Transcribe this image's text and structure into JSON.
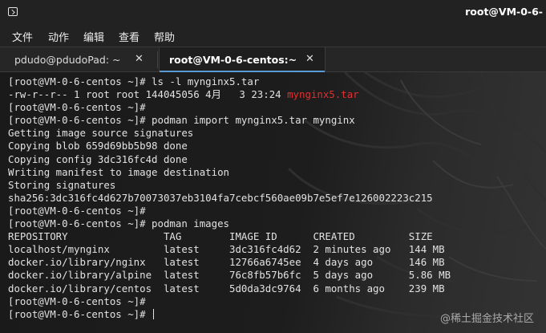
{
  "window": {
    "title": "root@VM-0-6-"
  },
  "menu": {
    "items": [
      "文件",
      "动作",
      "编辑",
      "查看",
      "帮助"
    ]
  },
  "tabs": [
    {
      "label": "pdudo@pdudoPad: ~",
      "close": "✕",
      "active": false
    },
    {
      "label": "root@VM-0-6-centos:~",
      "close": "✕",
      "active": true
    }
  ],
  "terminal": {
    "lines": [
      {
        "text": "[root@VM-0-6-centos ~]# ls -l mynginx5.tar"
      },
      {
        "text": "-rw-r--r-- 1 root root 144045056 4月   3 23:24 ",
        "highlight": "mynginx5.tar"
      },
      {
        "text": "[root@VM-0-6-centos ~]#"
      },
      {
        "text": "[root@VM-0-6-centos ~]# podman import mynginx5.tar mynginx"
      },
      {
        "text": "Getting image source signatures"
      },
      {
        "text": "Copying blob 659d69bb5b98 done"
      },
      {
        "text": "Copying config 3dc316fc4d done"
      },
      {
        "text": "Writing manifest to image destination"
      },
      {
        "text": "Storing signatures"
      },
      {
        "text": "sha256:3dc316fc4d627b70073037eb3104fa7cebcf560ae09b7e5ef7e126002223c215"
      },
      {
        "text": "[root@VM-0-6-centos ~]#"
      },
      {
        "text": "[root@VM-0-6-centos ~]# podman images"
      },
      {
        "text": "REPOSITORY                TAG        IMAGE ID      CREATED         SIZE"
      },
      {
        "text": "localhost/mynginx         latest     3dc316fc4d62  2 minutes ago   144 MB"
      },
      {
        "text": "docker.io/library/nginx   latest     12766a6745ee  4 days ago      146 MB"
      },
      {
        "text": "docker.io/library/alpine  latest     76c8fb57b6fc  5 days ago      5.86 MB"
      },
      {
        "text": "docker.io/library/centos  latest     5d0da3dc9764  6 months ago    239 MB"
      },
      {
        "text": "[root@VM-0-6-centos ~]#"
      },
      {
        "text": "[root@VM-0-6-centos ~]# ",
        "cursor": true
      }
    ],
    "highlight_color": "#e03030"
  },
  "watermark": "@稀土掘金技术社区",
  "icons": {
    "app": "terminal-window-icon",
    "tab_close": "close-icon"
  }
}
